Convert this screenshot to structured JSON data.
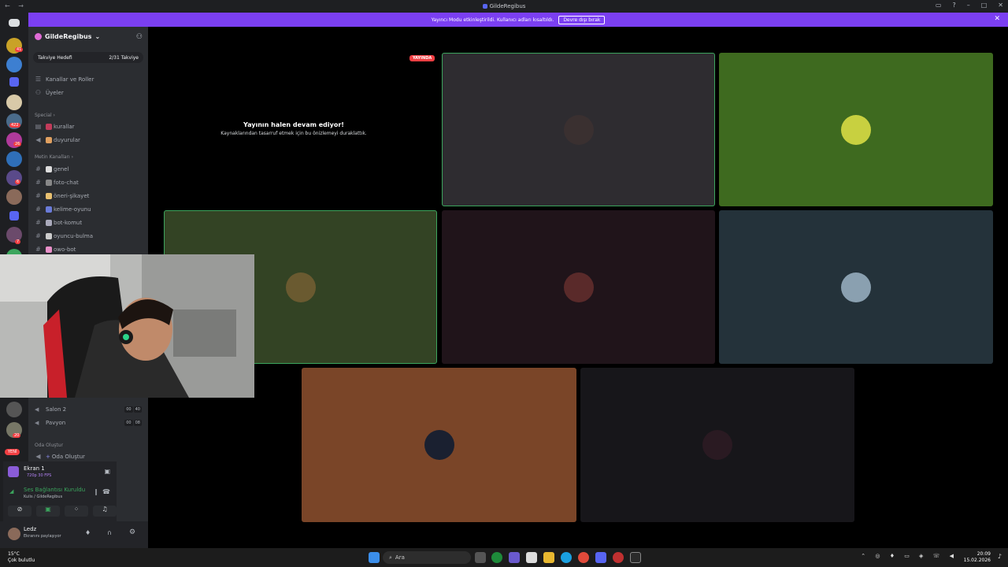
{
  "window": {
    "title": "GildeRegibus"
  },
  "banner": {
    "text": "Yayıncı Modu etkinleştirildi. Kullanıcı adları kısaltıldı.",
    "button": "Devre dışı bırak"
  },
  "rail": {
    "badges": [
      "41",
      "422",
      "26",
      "6",
      "20",
      "7",
      "YENİ"
    ]
  },
  "server": {
    "name": "GildeRegibus",
    "boost_label": "Takviye Hedefi",
    "boost_value": "2/31 Takviye"
  },
  "sidebar": {
    "top_items": [
      "Kanallar ve Roller",
      "Üyeler"
    ],
    "cat_special": "Special",
    "special": [
      "kurallar",
      "duyurular"
    ],
    "cat_text": "Metin Kanalları",
    "text_channels": [
      "genel",
      "foto-chat",
      "öneri-şikayet",
      "kelime-oyunu",
      "bot-komut",
      "oyuncu-bulma",
      "owo-bot"
    ],
    "voice": [
      {
        "name": "Salon 2",
        "a": "00",
        "b": "40"
      },
      {
        "name": "Pavyon",
        "a": "00",
        "b": "08"
      }
    ],
    "cat_room": "Oda Oluştur",
    "room_create": "Oda Oluştur"
  },
  "screen_share": {
    "title": "Ekran 1",
    "sub": "720p 30 FPS"
  },
  "voice_status": {
    "title": "Ses Bağlantısı Kuruldu",
    "sub": "Kulis / GildeRegibus"
  },
  "user": {
    "name": "Ledz",
    "status": "Ekranını paylaşıyor"
  },
  "stream": {
    "live": "YAYINDA",
    "heading": "Yayının halen devam ediyor!",
    "sub": "Kaynaklarından tasarruf etmek için bu önizlemeyi duraklattık."
  },
  "taskbar": {
    "temp": "15°C",
    "weather": "Çok bulutlu",
    "search": "Ara",
    "time": "20:09",
    "date": "15.02.2026"
  },
  "colors": {
    "accent": "#5865f2",
    "banner": "#7b3ff2",
    "live": "#f23f43",
    "speaking": "#3ba55d"
  }
}
